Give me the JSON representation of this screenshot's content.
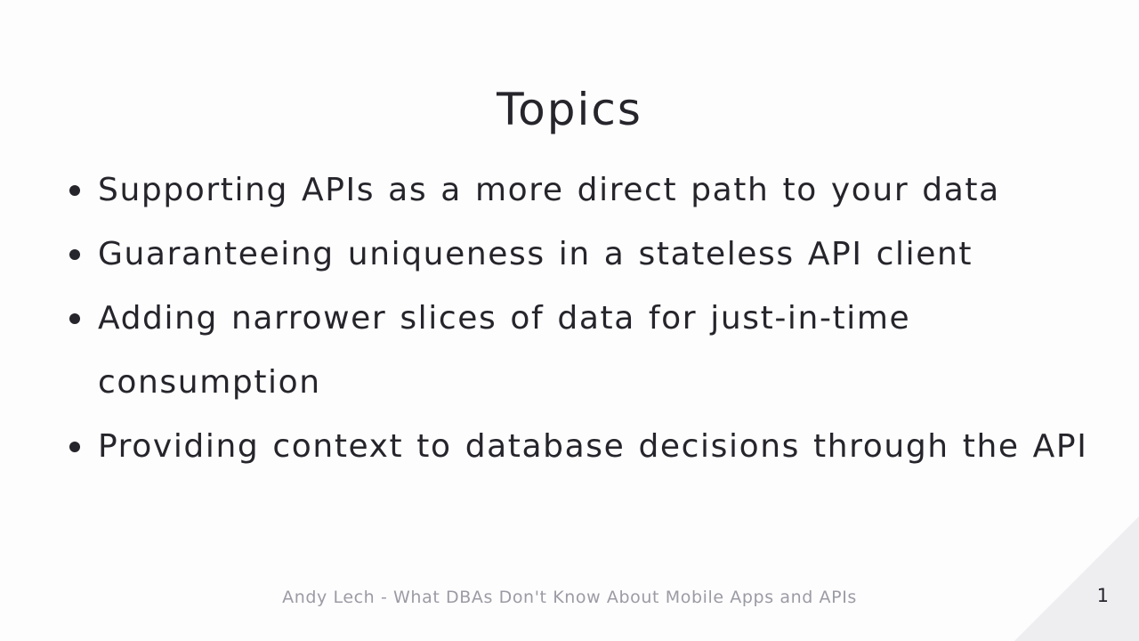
{
  "slide": {
    "title": "Topics",
    "bullets": [
      "Supporting APIs as a more direct path to your data",
      "Guaranteeing uniqueness in a stateless API client",
      "Adding narrower slices of data for just-in-time consumption",
      "Providing context to database decisions through the API"
    ],
    "footer": "Andy Lech - What DBAs Don't Know About Mobile Apps and APIs",
    "page_number": "1"
  }
}
